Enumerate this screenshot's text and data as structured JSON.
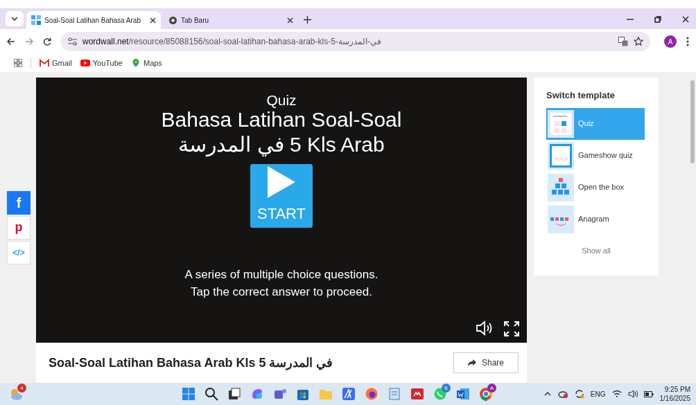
{
  "browser": {
    "tabs": [
      {
        "title": "Soal-Soal Latihan Bahasa Arab",
        "selected": true
      },
      {
        "title": "Tab Baru",
        "selected": false
      }
    ],
    "address": {
      "domain": "wordwall.net",
      "path": "/resource/85088156/soal-soal-latihan-bahasa-arab-kls-5-في-المدرسة"
    },
    "profile_initial": "A",
    "bookmarks": [
      {
        "label": "Gmail",
        "kind": "mail"
      },
      {
        "label": "YouTube",
        "kind": "video"
      },
      {
        "label": "Maps",
        "kind": "map"
      }
    ]
  },
  "share_buttons": [
    {
      "kind": "facebook",
      "glyph": "f"
    },
    {
      "kind": "pinterest",
      "glyph": "p"
    },
    {
      "kind": "embed",
      "glyph": "</>"
    }
  ],
  "activity": {
    "type_label": "Quiz",
    "title_line_1": "Bahasa Latihan Soal-Soal",
    "title_line_2_parts": [
      "في المدرسة",
      "5 Kls Arab"
    ],
    "start_label": "START",
    "description_lines": [
      "A series of multiple choice questions.",
      "Tap the correct answer to proceed."
    ]
  },
  "resource_title": "Soal-Soal Latihan Bahasa Arab Kls 5 في المدرسة",
  "share_label": "Share",
  "switch_template": {
    "heading": "Switch template",
    "items": [
      {
        "label": "Quiz",
        "kind": "quiz",
        "selected": true
      },
      {
        "label": "Gameshow quiz",
        "kind": "gameshow",
        "selected": false
      },
      {
        "label": "Open the box",
        "kind": "boxes",
        "selected": false
      },
      {
        "label": "Anagram",
        "kind": "anagram",
        "selected": false
      }
    ],
    "show_all": "Show all"
  },
  "taskbar": {
    "weather_badge": "4",
    "chat_badge": "6",
    "profile_badge": "A",
    "language": "ENG",
    "time": "9:25 PM",
    "date": "1/16/2025"
  }
}
